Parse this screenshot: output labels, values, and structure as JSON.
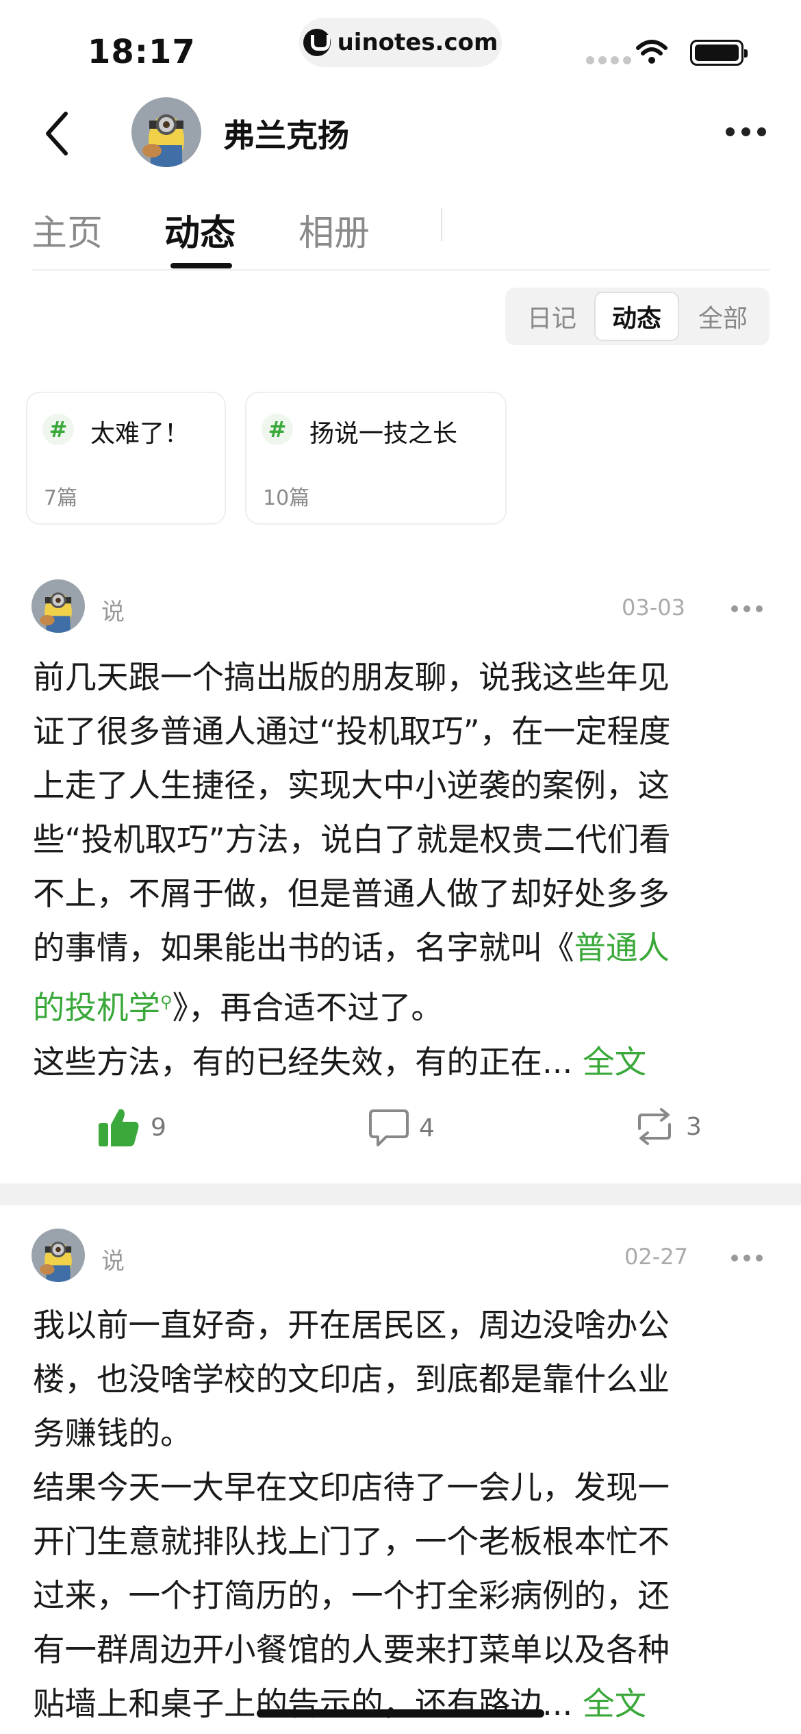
{
  "status_bar": {
    "time": "18:17",
    "url": "uinotes.com"
  },
  "header": {
    "name": "弗兰克扬"
  },
  "tabs": [
    {
      "label": "主页",
      "active": false
    },
    {
      "label": "动态",
      "active": true
    },
    {
      "label": "相册",
      "active": false
    }
  ],
  "filter": [
    {
      "label": "日记",
      "active": false
    },
    {
      "label": "动态",
      "active": true
    },
    {
      "label": "全部",
      "active": false
    }
  ],
  "topics": [
    {
      "hash": "#",
      "name": "太难了！",
      "count": "7篇"
    },
    {
      "hash": "#",
      "name": "扬说一技之长",
      "count": "10篇"
    }
  ],
  "posts": [
    {
      "type": "说",
      "date": "03-03",
      "line1": "前几天跟一个搞出版的朋友聊，说我这些年见",
      "line2": "证了很多普通人通过“投机取巧”，在一定程度",
      "line3": "上走了人生捷径，实现大中小逆袭的案例，这",
      "line4": "些“投机取巧”方法，说白了就是权贵二代们看",
      "line5": "不上，不屑于做，但是普通人做了却好处多多",
      "line6_pre": "的事情，如果能出书的话，名字就叫《",
      "line6_link": "普通人",
      "line7_link": "的投机学",
      "line7_post": "》，再合适不过了。",
      "line8": "这些方法，有的已经失效，有的正在...",
      "full_text": "全文",
      "likes": "9",
      "comments": "4",
      "reposts": "3"
    },
    {
      "type": "说",
      "date": "02-27",
      "line1": "我以前一直好奇，开在居民区，周边没啥办公",
      "line2": "楼，也没啥学校的文印店，到底都是靠什么业",
      "line3": "务赚钱的。",
      "line4": "结果今天一大早在文印店待了一会儿，发现一",
      "line5": "开门生意就排队找上门了，一个老板根本忙不",
      "line6": "过来，一个打简历的，一个打全彩病例的，还",
      "line7": "有一群周边开小餐馆的人要来打菜单以及各种",
      "line8": "贴墙上和桌子上的告示的，还有路边...",
      "full_text": "全文"
    }
  ],
  "colors": {
    "accent_green": "#3aa83a",
    "text": "#1a1a1a",
    "muted": "#8a8a8a"
  }
}
